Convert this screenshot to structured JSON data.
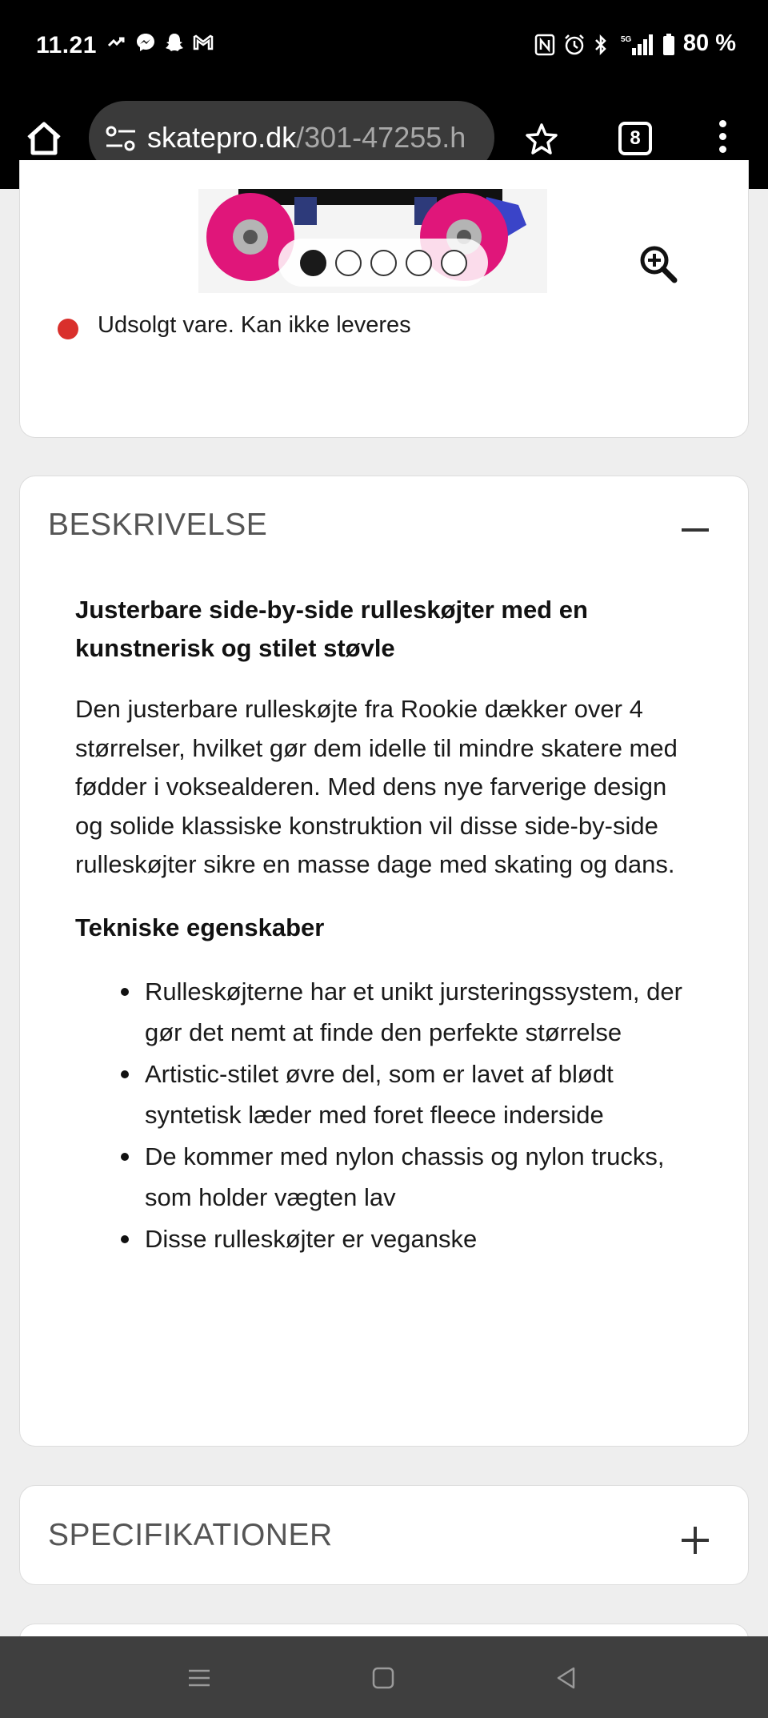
{
  "status_bar": {
    "time": "11.21",
    "left_icons": [
      "missed-call-icon",
      "messenger-icon",
      "snapchat-icon",
      "gmail-icon"
    ],
    "right_icons": [
      "nfc-icon",
      "alarm-icon",
      "bluetooth-icon",
      "5g-signal-icon",
      "battery-icon"
    ],
    "battery": "80 %"
  },
  "browser": {
    "url_domain": "skatepro.dk",
    "url_path": "/301-47255.h",
    "tab_count": "8"
  },
  "product": {
    "carousel": {
      "total": 5,
      "active_index": 0
    },
    "stock_status": "Udsolgt vare. Kan ikke leveres",
    "stock_color": "#d9302c"
  },
  "description": {
    "section_title": "BESKRIVELSE",
    "heading": "Justerbare side-by-side rulleskøjter med en kunstnerisk og stilet støvle",
    "paragraph": "Den justerbare rulleskøjte fra Rookie dækker over 4 størrelser, hvilket gør dem idelle til mindre skatere med fødder i voksealderen. Med dens nye farverige design og solide klassiske konstruktion vil disse side-by-side rulleskøjter sikre en masse dage med skating og dans.",
    "features_heading": "Tekniske egenskaber",
    "features": [
      "Rulleskøjterne har et unikt jursteringssystem, der gør det nemt at finde den perfekte størrelse",
      "Artistic-stilet øvre del, som er lavet af blødt syntetisk læder med foret fleece inderside",
      "De kommer med nylon chassis og nylon trucks, som holder vægten lav",
      "Disse rulleskøjter er veganske"
    ]
  },
  "specifications": {
    "section_title": "SPECIFIKATIONER"
  }
}
